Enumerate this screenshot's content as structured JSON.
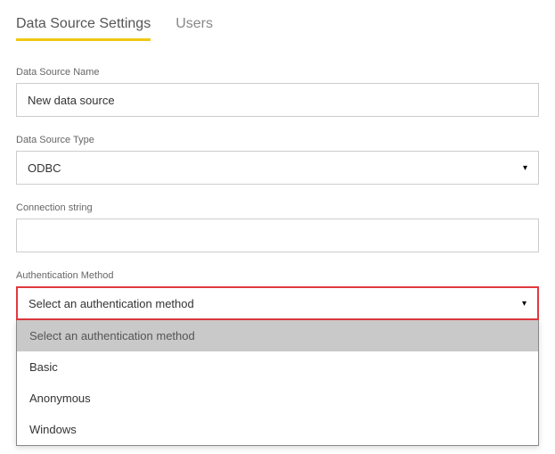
{
  "tabs": {
    "settings": "Data Source Settings",
    "users": "Users"
  },
  "fields": {
    "name": {
      "label": "Data Source Name",
      "value": "New data source"
    },
    "type": {
      "label": "Data Source Type",
      "value": "ODBC"
    },
    "conn": {
      "label": "Connection string",
      "value": ""
    },
    "auth": {
      "label": "Authentication Method",
      "value": "Select an authentication method",
      "options": {
        "placeholder": "Select an authentication method",
        "basic": "Basic",
        "anonymous": "Anonymous",
        "windows": "Windows"
      }
    }
  }
}
